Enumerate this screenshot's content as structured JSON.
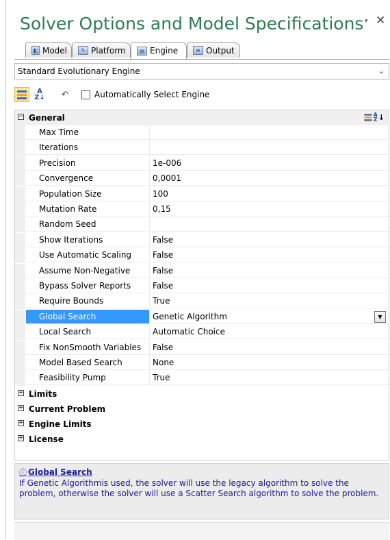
{
  "title": "Solver Options and Model Specifications",
  "title_icons": {
    "dropdown": "▾",
    "close": "✕"
  },
  "tabs": [
    {
      "label": "Model",
      "icon": "model-icon"
    },
    {
      "label": "Platform",
      "icon": "platform-icon"
    },
    {
      "label": "Engine",
      "icon": "engine-icon",
      "active": true
    },
    {
      "label": "Output",
      "icon": "output-icon"
    }
  ],
  "engine_select": {
    "value": "Standard Evolutionary Engine"
  },
  "toolbar": {
    "auto_select_label": "Automatically Select Engine",
    "auto_select_checked": false
  },
  "grid": {
    "general": {
      "label": "General",
      "expander": "⊟"
    },
    "properties": [
      {
        "name": "Max Time",
        "value": ""
      },
      {
        "name": "Iterations",
        "value": ""
      },
      {
        "name": "Precision",
        "value": "1e-006"
      },
      {
        "name": "Convergence",
        "value": "0,0001"
      },
      {
        "name": "Population Size",
        "value": "100"
      },
      {
        "name": "Mutation Rate",
        "value": "0,15"
      },
      {
        "name": "Random Seed",
        "value": ""
      },
      {
        "name": "Show Iterations",
        "value": "False"
      },
      {
        "name": "Use Automatic Scaling",
        "value": "False"
      },
      {
        "name": "Assume Non-Negative",
        "value": "False"
      },
      {
        "name": "Bypass Solver Reports",
        "value": "False"
      },
      {
        "name": "Require Bounds",
        "value": "True"
      },
      {
        "name": "Global Search",
        "value": "Genetic Algorithm",
        "selected": true
      },
      {
        "name": "Local Search",
        "value": "Automatic Choice"
      },
      {
        "name": "Fix NonSmooth Variables",
        "value": "False"
      },
      {
        "name": "Model Based Search",
        "value": "None"
      },
      {
        "name": "Feasibility Pump",
        "value": "True"
      }
    ],
    "collapsed_categories": [
      {
        "label": "Limits"
      },
      {
        "label": "Current Problem"
      },
      {
        "label": "Engine Limits"
      },
      {
        "label": "License"
      }
    ]
  },
  "help": {
    "title": "Global Search",
    "text": "If Genetic Algorithmis used, the solver will use the legacy algorithm to solve the problem, otherwise the solver will use a Scatter Search algorithm to solve the problem."
  }
}
